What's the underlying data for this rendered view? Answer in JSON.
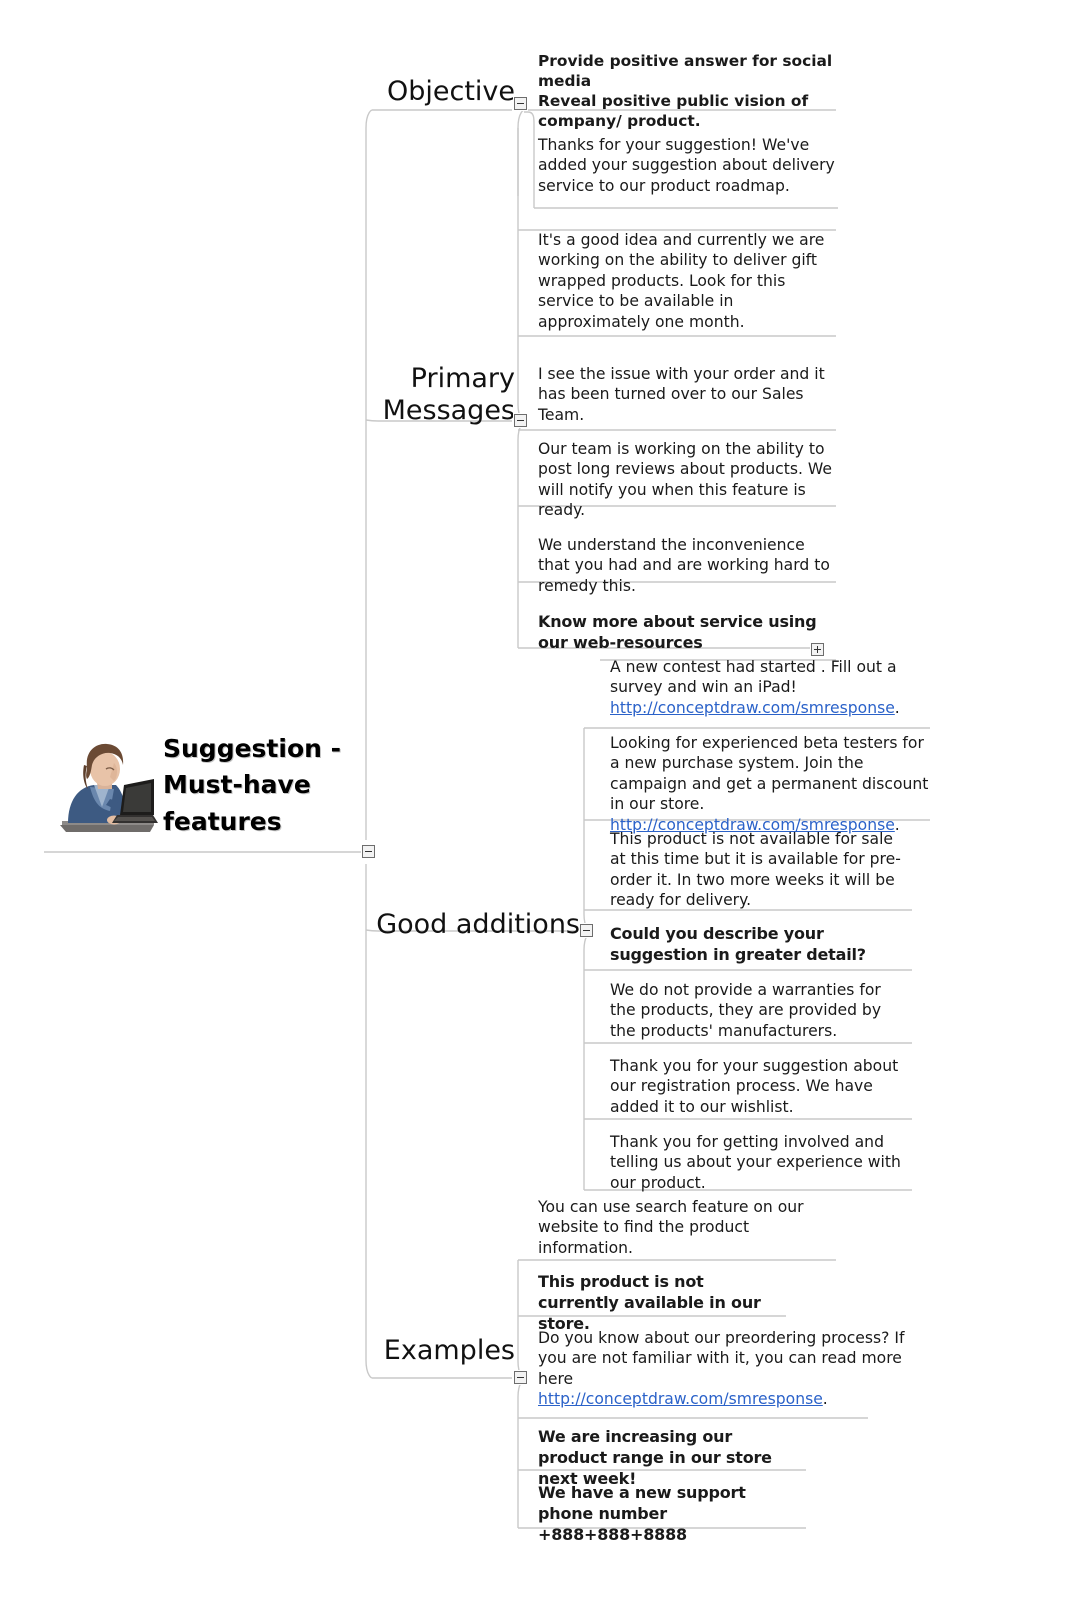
{
  "central": {
    "title": "Suggestion -\nMust-have\nfeatures",
    "image_icon": "woman-at-laptop-illustration"
  },
  "branches": [
    {
      "id": "objective",
      "label": "Objective",
      "toggle": "minus"
    },
    {
      "id": "primary-messages",
      "label": "Primary\nMessages",
      "toggle": "minus"
    },
    {
      "id": "good-additions",
      "label": "Good additions",
      "toggle": "minus"
    },
    {
      "id": "examples",
      "label": "Examples",
      "toggle": "minus"
    }
  ],
  "nodes": {
    "objective_1": "Provide positive answer for social media\nReveal positive public vision of company/ product.",
    "pm_1": "Thanks for your suggestion! We've added your suggestion about delivery service to our product roadmap.",
    "pm_2": "It's a good idea and currently we are working on the ability to deliver gift wrapped products. Look for this service to be available in approximately one month.",
    "pm_3": "I see the issue with your order and it has been turned over to our Sales Team.",
    "pm_4": "Our team is working on the ability to post long reviews about products. We will notify you when this feature is ready.",
    "pm_5": "We understand the inconvenience that you had and are working hard to remedy this.",
    "ga_parent": "Know more about service using our web-resources",
    "ga_1_text": "A new contest had started . Fill out a survey and win an iPad!\n",
    "ga_1_link": "http://conceptdraw.com/smresponse",
    "ga_1_tail": ".",
    "ga_2_text": "Looking for experienced beta testers for a new purchase system. Join the campaign and get a permanent discount in our store.\n",
    "ga_2_link": "http://conceptdraw.com/smresponse",
    "ga_2_tail": ".",
    "ga_3": "This product is not available for sale at this time but it is available for pre-order it. In two more weeks it will be ready for delivery.",
    "ga_4": "Could you describe your suggestion in greater detail?",
    "ga_5": "We do not provide a warranties for the products, they are provided by the products' manufacturers.",
    "ga_6": "Thank you for your suggestion about our registration process. We have added it to our wishlist.",
    "ga_7": "Thank you for getting involved and telling us about your experience with our product.",
    "ex_1": "You can use search feature on our website to find the product information.",
    "ex_2": "This product is not currently available in our store.",
    "ex_3_text": "Do you know about our preordering process? If you are not familiar with it, you can read more here\n",
    "ex_3_link": "http://conceptdraw.com/smresponse",
    "ex_3_tail": ".",
    "ex_4": "We are increasing our product range in our store next week!",
    "ex_5": "We have a new support phone number +888+888+8888"
  },
  "colors": {
    "link": "#2b62c9",
    "connector": "#c8c8c8",
    "text": "#1a1a1a",
    "toggle_border": "#6d6d6d"
  },
  "toggles": {
    "central": "minus",
    "objective": "minus",
    "primary_messages": "minus",
    "good_additions_parent": "plus",
    "good_additions": "minus",
    "examples": "minus"
  }
}
